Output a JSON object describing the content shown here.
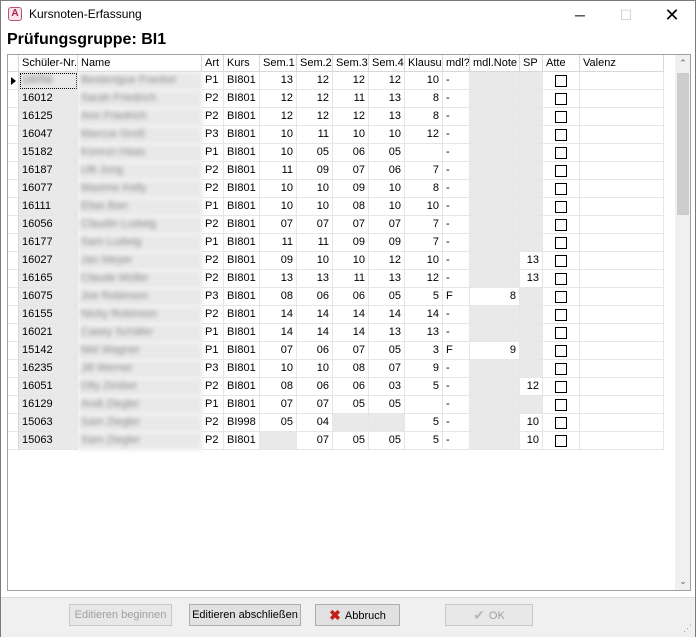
{
  "window": {
    "title": "Kursnoten-Erfassung",
    "icon_name": "app-logo-icon",
    "minimize_symbol": "─",
    "maximize_symbol": "☐",
    "close_symbol": "✕"
  },
  "group_title": "Prüfungsgruppe: BI1",
  "table": {
    "columns": [
      "Schüler-Nr.",
      "Name",
      "Art",
      "Kurs",
      "Sem.1",
      "Sem.2",
      "Sem.3",
      "Sem.4",
      "Klausur",
      "mdl?",
      "mdl.Note",
      "SP",
      "Atte",
      "Valenz"
    ],
    "rows": [
      {
        "nr": "16056",
        "name": "Bestenigue Frankel",
        "art": "P1",
        "kurs": "BI801",
        "s1": "13",
        "s2": "12",
        "s3": "12",
        "s4": "12",
        "klausur": "10",
        "mdl": "-",
        "mdl_note": "",
        "sp": "",
        "atte": false
      },
      {
        "nr": "16012",
        "name": "Sarah Friedrich",
        "art": "P2",
        "kurs": "BI801",
        "s1": "12",
        "s2": "12",
        "s3": "11",
        "s4": "13",
        "klausur": "8",
        "mdl": "-",
        "mdl_note": "",
        "sp": "",
        "atte": false
      },
      {
        "nr": "16125",
        "name": "Ann Friedrich",
        "art": "P2",
        "kurs": "BI801",
        "s1": "12",
        "s2": "12",
        "s3": "12",
        "s4": "13",
        "klausur": "8",
        "mdl": "-",
        "mdl_note": "",
        "sp": "",
        "atte": false
      },
      {
        "nr": "16047",
        "name": "Marcus Groß",
        "art": "P3",
        "kurs": "BI801",
        "s1": "10",
        "s2": "11",
        "s3": "10",
        "s4": "10",
        "klausur": "12",
        "mdl": "-",
        "mdl_note": "",
        "sp": "",
        "atte": false
      },
      {
        "nr": "15182",
        "name": "Konrun Haas",
        "art": "P1",
        "kurs": "BI801",
        "s1": "10",
        "s2": "05",
        "s3": "06",
        "s4": "05",
        "klausur": "",
        "mdl": "-",
        "mdl_note": "",
        "sp": "",
        "atte": false
      },
      {
        "nr": "16187",
        "name": "Ulli Jung",
        "art": "P2",
        "kurs": "BI801",
        "s1": "11",
        "s2": "09",
        "s3": "07",
        "s4": "06",
        "klausur": "7",
        "mdl": "-",
        "mdl_note": "",
        "sp": "",
        "atte": false
      },
      {
        "nr": "16077",
        "name": "Maxime Kelly",
        "art": "P2",
        "kurs": "BI801",
        "s1": "10",
        "s2": "10",
        "s3": "09",
        "s4": "10",
        "klausur": "8",
        "mdl": "-",
        "mdl_note": "",
        "sp": "",
        "atte": false
      },
      {
        "nr": "16111",
        "name": "Elias Barr",
        "art": "P1",
        "kurs": "BI801",
        "s1": "10",
        "s2": "10",
        "s3": "08",
        "s4": "10",
        "klausur": "10",
        "mdl": "-",
        "mdl_note": "",
        "sp": "",
        "atte": false
      },
      {
        "nr": "16056",
        "name": "Claudin Ludwig",
        "art": "P2",
        "kurs": "BI801",
        "s1": "07",
        "s2": "07",
        "s3": "07",
        "s4": "07",
        "klausur": "7",
        "mdl": "-",
        "mdl_note": "",
        "sp": "",
        "atte": false
      },
      {
        "nr": "16177",
        "name": "Sam Ludwig",
        "art": "P1",
        "kurs": "BI801",
        "s1": "11",
        "s2": "11",
        "s3": "09",
        "s4": "09",
        "klausur": "7",
        "mdl": "-",
        "mdl_note": "",
        "sp": "",
        "atte": false
      },
      {
        "nr": "16027",
        "name": "Jan Meyer",
        "art": "P2",
        "kurs": "BI801",
        "s1": "09",
        "s2": "10",
        "s3": "10",
        "s4": "12",
        "klausur": "10",
        "mdl": "-",
        "mdl_note": "",
        "sp": "13",
        "atte": false
      },
      {
        "nr": "16165",
        "name": "Claude Müller",
        "art": "P2",
        "kurs": "BI801",
        "s1": "13",
        "s2": "13",
        "s3": "11",
        "s4": "13",
        "klausur": "12",
        "mdl": "-",
        "mdl_note": "",
        "sp": "13",
        "atte": false
      },
      {
        "nr": "16075",
        "name": "Joe Robinson",
        "art": "P3",
        "kurs": "BI801",
        "s1": "08",
        "s2": "06",
        "s3": "06",
        "s4": "05",
        "klausur": "5",
        "mdl": "F",
        "mdl_note": "8",
        "sp": "",
        "atte": false
      },
      {
        "nr": "16155",
        "name": "Nicky Robinson",
        "art": "P2",
        "kurs": "BI801",
        "s1": "14",
        "s2": "14",
        "s3": "14",
        "s4": "14",
        "klausur": "14",
        "mdl": "-",
        "mdl_note": "",
        "sp": "",
        "atte": false
      },
      {
        "nr": "16021",
        "name": "Casey Schäfer",
        "art": "P1",
        "kurs": "BI801",
        "s1": "14",
        "s2": "14",
        "s3": "14",
        "s4": "13",
        "klausur": "13",
        "mdl": "-",
        "mdl_note": "",
        "sp": "",
        "atte": false
      },
      {
        "nr": "15142",
        "name": "Mel Wagner",
        "art": "P1",
        "kurs": "BI801",
        "s1": "07",
        "s2": "06",
        "s3": "07",
        "s4": "05",
        "klausur": "3",
        "mdl": "F",
        "mdl_note": "9",
        "sp": "",
        "atte": false
      },
      {
        "nr": "16235",
        "name": "Jill Werner",
        "art": "P3",
        "kurs": "BI801",
        "s1": "10",
        "s2": "10",
        "s3": "08",
        "s4": "07",
        "klausur": "9",
        "mdl": "-",
        "mdl_note": "",
        "sp": "",
        "atte": false
      },
      {
        "nr": "16051",
        "name": "Olly Zimber",
        "art": "P2",
        "kurs": "BI801",
        "s1": "08",
        "s2": "06",
        "s3": "06",
        "s4": "03",
        "klausur": "5",
        "mdl": "-",
        "mdl_note": "",
        "sp": "12",
        "atte": false
      },
      {
        "nr": "16129",
        "name": "Andi Ziegler",
        "art": "P1",
        "kurs": "BI801",
        "s1": "07",
        "s2": "07",
        "s3": "05",
        "s4": "05",
        "klausur": "",
        "mdl": "-",
        "mdl_note": "",
        "sp": "",
        "atte": false
      },
      {
        "nr": "15063",
        "name": "Sam Ziegler",
        "art": "P2",
        "kurs": "BI998",
        "s1": "05",
        "s2": "04",
        "s3": "",
        "s4": "",
        "klausur": "5",
        "mdl": "-",
        "mdl_note": "",
        "sp": "10",
        "atte": false
      },
      {
        "nr": "15063",
        "name": "Sam Ziegler",
        "art": "P2",
        "kurs": "BI801",
        "s1": "",
        "s2": "07",
        "s3": "05",
        "s4": "05",
        "klausur": "5",
        "mdl": "-",
        "mdl_note": "",
        "sp": "10",
        "atte": false
      }
    ]
  },
  "scrollbar": {
    "up_symbol": "⌃",
    "down_symbol": "⌄"
  },
  "buttons": {
    "edit_begin": "Editieren beginnen",
    "edit_end": "Editieren abschließen",
    "cancel": "Abbruch",
    "cancel_icon": "✖",
    "ok": "OK",
    "ok_icon": "✔"
  },
  "colors": {
    "cancel_icon": "#c0201a",
    "readonly_cell": "#e9e9e9"
  }
}
